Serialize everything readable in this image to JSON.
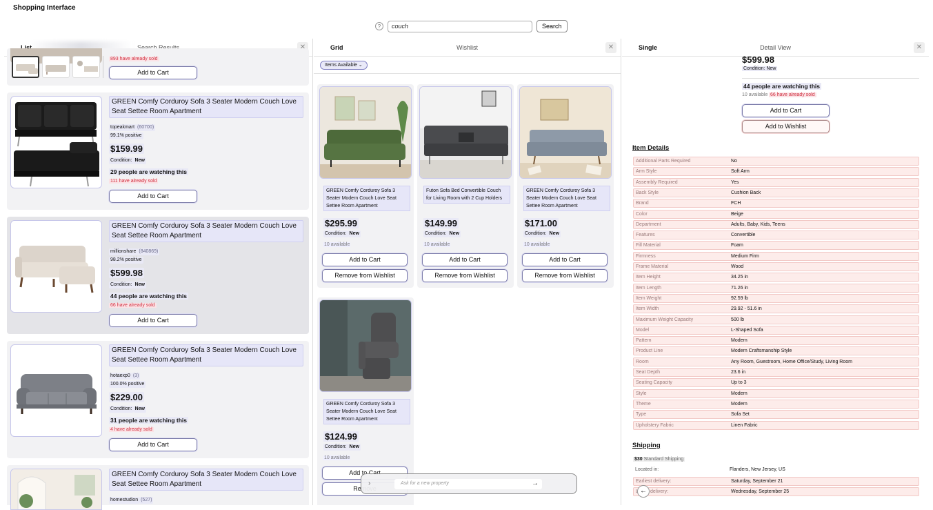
{
  "app_title": "Shopping Interface",
  "search": {
    "value": "couch",
    "button": "Search",
    "help": "?"
  },
  "list_panel": {
    "tab": "List",
    "title": "Search Results",
    "close": "✕"
  },
  "grid_panel": {
    "tab": "Grid",
    "title": "Wishlist",
    "close": "✕",
    "filter": "Items Available ⌄"
  },
  "detail_panel": {
    "tab": "Single",
    "title": "Detail View",
    "close": "✕"
  },
  "list_top": {
    "sold": "893 have already sold",
    "button": "Add to Cart"
  },
  "list_items": [
    {
      "title": "GREEN Comfy Corduroy Sofa 3 Seater Modern Couch Love Seat Settee Room Apartment",
      "seller": "topeakmart",
      "count": "(60700)",
      "positive": "99.1% positive",
      "price": "$159.99",
      "condition_label": "Condition:",
      "condition": "New",
      "watching": "29 people are watching this",
      "sold": "111 have already sold",
      "button": "Add to Cart"
    },
    {
      "title": "GREEN Comfy Corduroy Sofa 3 Seater Modern Couch Love Seat Settee Room Apartment",
      "seller": "millionshare",
      "count": "(840869)",
      "positive": "98.2% positive",
      "price": "$599.98",
      "condition_label": "Condition:",
      "condition": "New",
      "watching": "44 people are watching this",
      "sold": "66 have already sold",
      "button": "Add to Cart"
    },
    {
      "title": "GREEN Comfy Corduroy Sofa 3 Seater Modern Couch Love Seat Settee Room Apartment",
      "seller": "hotaexp0",
      "count": "(3)",
      "positive": "100.0% positive",
      "price": "$229.00",
      "condition_label": "Condition:",
      "condition": "New",
      "watching": "31 people are watching this",
      "sold": "4 have already sold",
      "button": "Add to Cart"
    },
    {
      "title": "GREEN Comfy Corduroy Sofa 3 Seater Modern Couch Love Seat Settee Room Apartment",
      "seller": "homestudion",
      "count": "(527)"
    }
  ],
  "grid_items": [
    {
      "title": "GREEN Comfy Corduroy Sofa 3 Seater Modern Couch Love Seat Settee Room Apartment",
      "price": "$295.99",
      "condition_label": "Condition:",
      "condition": "New",
      "available": "10 available",
      "cart": "Add to Cart",
      "remove": "Remove from Wishlist"
    },
    {
      "title": "Futon Sofa Bed Convertible Couch for Living Room with 2 Cup Holders",
      "price": "$149.99",
      "condition_label": "Condition:",
      "condition": "New",
      "available": "10 available",
      "cart": "Add to Cart",
      "remove": "Remove from Wishlist"
    },
    {
      "title": "GREEN Comfy Corduroy Sofa 3 Seater Modern Couch Love Seat Settee Room Apartment",
      "price": "$171.00",
      "condition_label": "Condition:",
      "condition": "New",
      "available": "10 available",
      "cart": "Add to Cart",
      "remove": "Remove from Wishlist"
    },
    {
      "title": "GREEN Comfy Corduroy Sofa 3 Seater Modern Couch Love Seat Settee Room Apartment",
      "price": "$124.99",
      "condition_label": "Condition:",
      "condition": "New",
      "available": "10 available",
      "cart": "Add to Cart",
      "remove": "Remove"
    }
  ],
  "ask_bar": {
    "placeholder": "Ask for a new property",
    "chevron": "›",
    "arrow": "→"
  },
  "detail": {
    "price": "$599.98",
    "condition": "Condition: New",
    "watching": "44 people are watching this",
    "available": "10 available",
    "sold": "66 have already sold",
    "cart": "Add to Cart",
    "wishlist": "Add to Wishlist",
    "item_details_heading": "Item Details",
    "item_details": [
      {
        "k": "Additional Parts Required",
        "v": "No"
      },
      {
        "k": "Arm Style",
        "v": "Soft Arm"
      },
      {
        "k": "Assembly Required",
        "v": "Yes"
      },
      {
        "k": "Back Style",
        "v": "Cushion Back"
      },
      {
        "k": "Brand",
        "v": "FCH"
      },
      {
        "k": "Color",
        "v": "Beige"
      },
      {
        "k": "Department",
        "v": "Adults, Baby, Kids, Teens"
      },
      {
        "k": "Features",
        "v": "Convertible"
      },
      {
        "k": "Fill Material",
        "v": "Foam"
      },
      {
        "k": "Firmness",
        "v": "Medium Firm"
      },
      {
        "k": "Frame Material",
        "v": "Wood"
      },
      {
        "k": "Item Height",
        "v": "34.25 in"
      },
      {
        "k": "Item Length",
        "v": "71.26 in"
      },
      {
        "k": "Item Weight",
        "v": "92.59 lb"
      },
      {
        "k": "Item Width",
        "v": "29.92 - 51.6 in"
      },
      {
        "k": "Maximum Weight Capacity",
        "v": "500 lb"
      },
      {
        "k": "Model",
        "v": "L-Shaped Sofa"
      },
      {
        "k": "Pattern",
        "v": "Modern"
      },
      {
        "k": "Product Line",
        "v": "Modern Craftsmanship Style"
      },
      {
        "k": "Room",
        "v": "Any Room, Guestroom, Home Office/Study, Living Room"
      },
      {
        "k": "Seat Depth",
        "v": "23.6 in"
      },
      {
        "k": "Seating Capacity",
        "v": "Up to 3"
      },
      {
        "k": "Style",
        "v": "Modern"
      },
      {
        "k": "Theme",
        "v": "Modern"
      },
      {
        "k": "Type",
        "v": "Sofa Set"
      },
      {
        "k": "Upholstery Fabric",
        "v": "Linen Fabric"
      }
    ],
    "shipping_heading": "Shipping",
    "shipping_cost": "$30",
    "shipping_label": "Standard Shipping",
    "shipping": [
      {
        "k": "Located in:",
        "v": "Flanders, New Jersey, US"
      },
      {
        "k": "Earliest delivery:",
        "v": "Saturday, September 21"
      },
      {
        "k": "Latest delivery:",
        "v": "Wednesday, September 25"
      }
    ],
    "back": "←"
  }
}
